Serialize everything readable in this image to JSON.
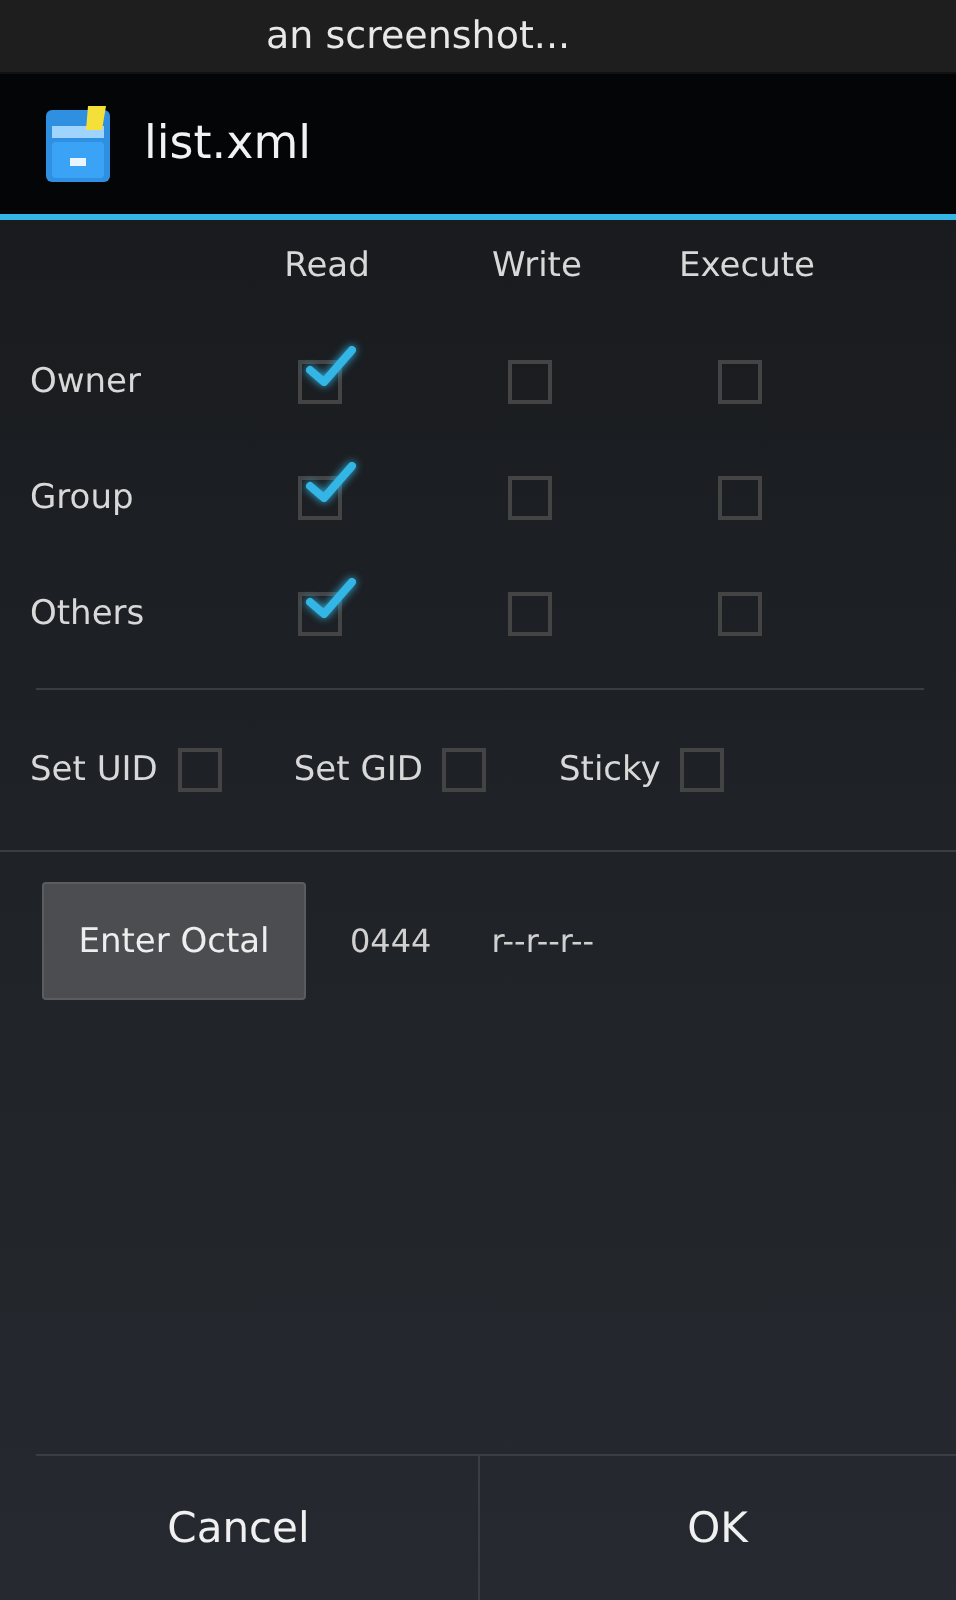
{
  "status_bar": {
    "notification": "an screenshot..."
  },
  "window": {
    "title": "list.xml"
  },
  "permissions": {
    "columns": [
      "Read",
      "Write",
      "Execute"
    ],
    "rows": [
      {
        "label": "Owner",
        "checks": [
          true,
          false,
          false
        ]
      },
      {
        "label": "Group",
        "checks": [
          true,
          false,
          false
        ]
      },
      {
        "label": "Others",
        "checks": [
          true,
          false,
          false
        ]
      }
    ]
  },
  "special": [
    {
      "label": "Set UID",
      "checked": false
    },
    {
      "label": "Set GID",
      "checked": false
    },
    {
      "label": "Sticky",
      "checked": false
    }
  ],
  "octal": {
    "button": "Enter Octal",
    "value": "0444",
    "symbolic": "r--r--r--"
  },
  "buttons": [
    "Cancel",
    "OK"
  ]
}
